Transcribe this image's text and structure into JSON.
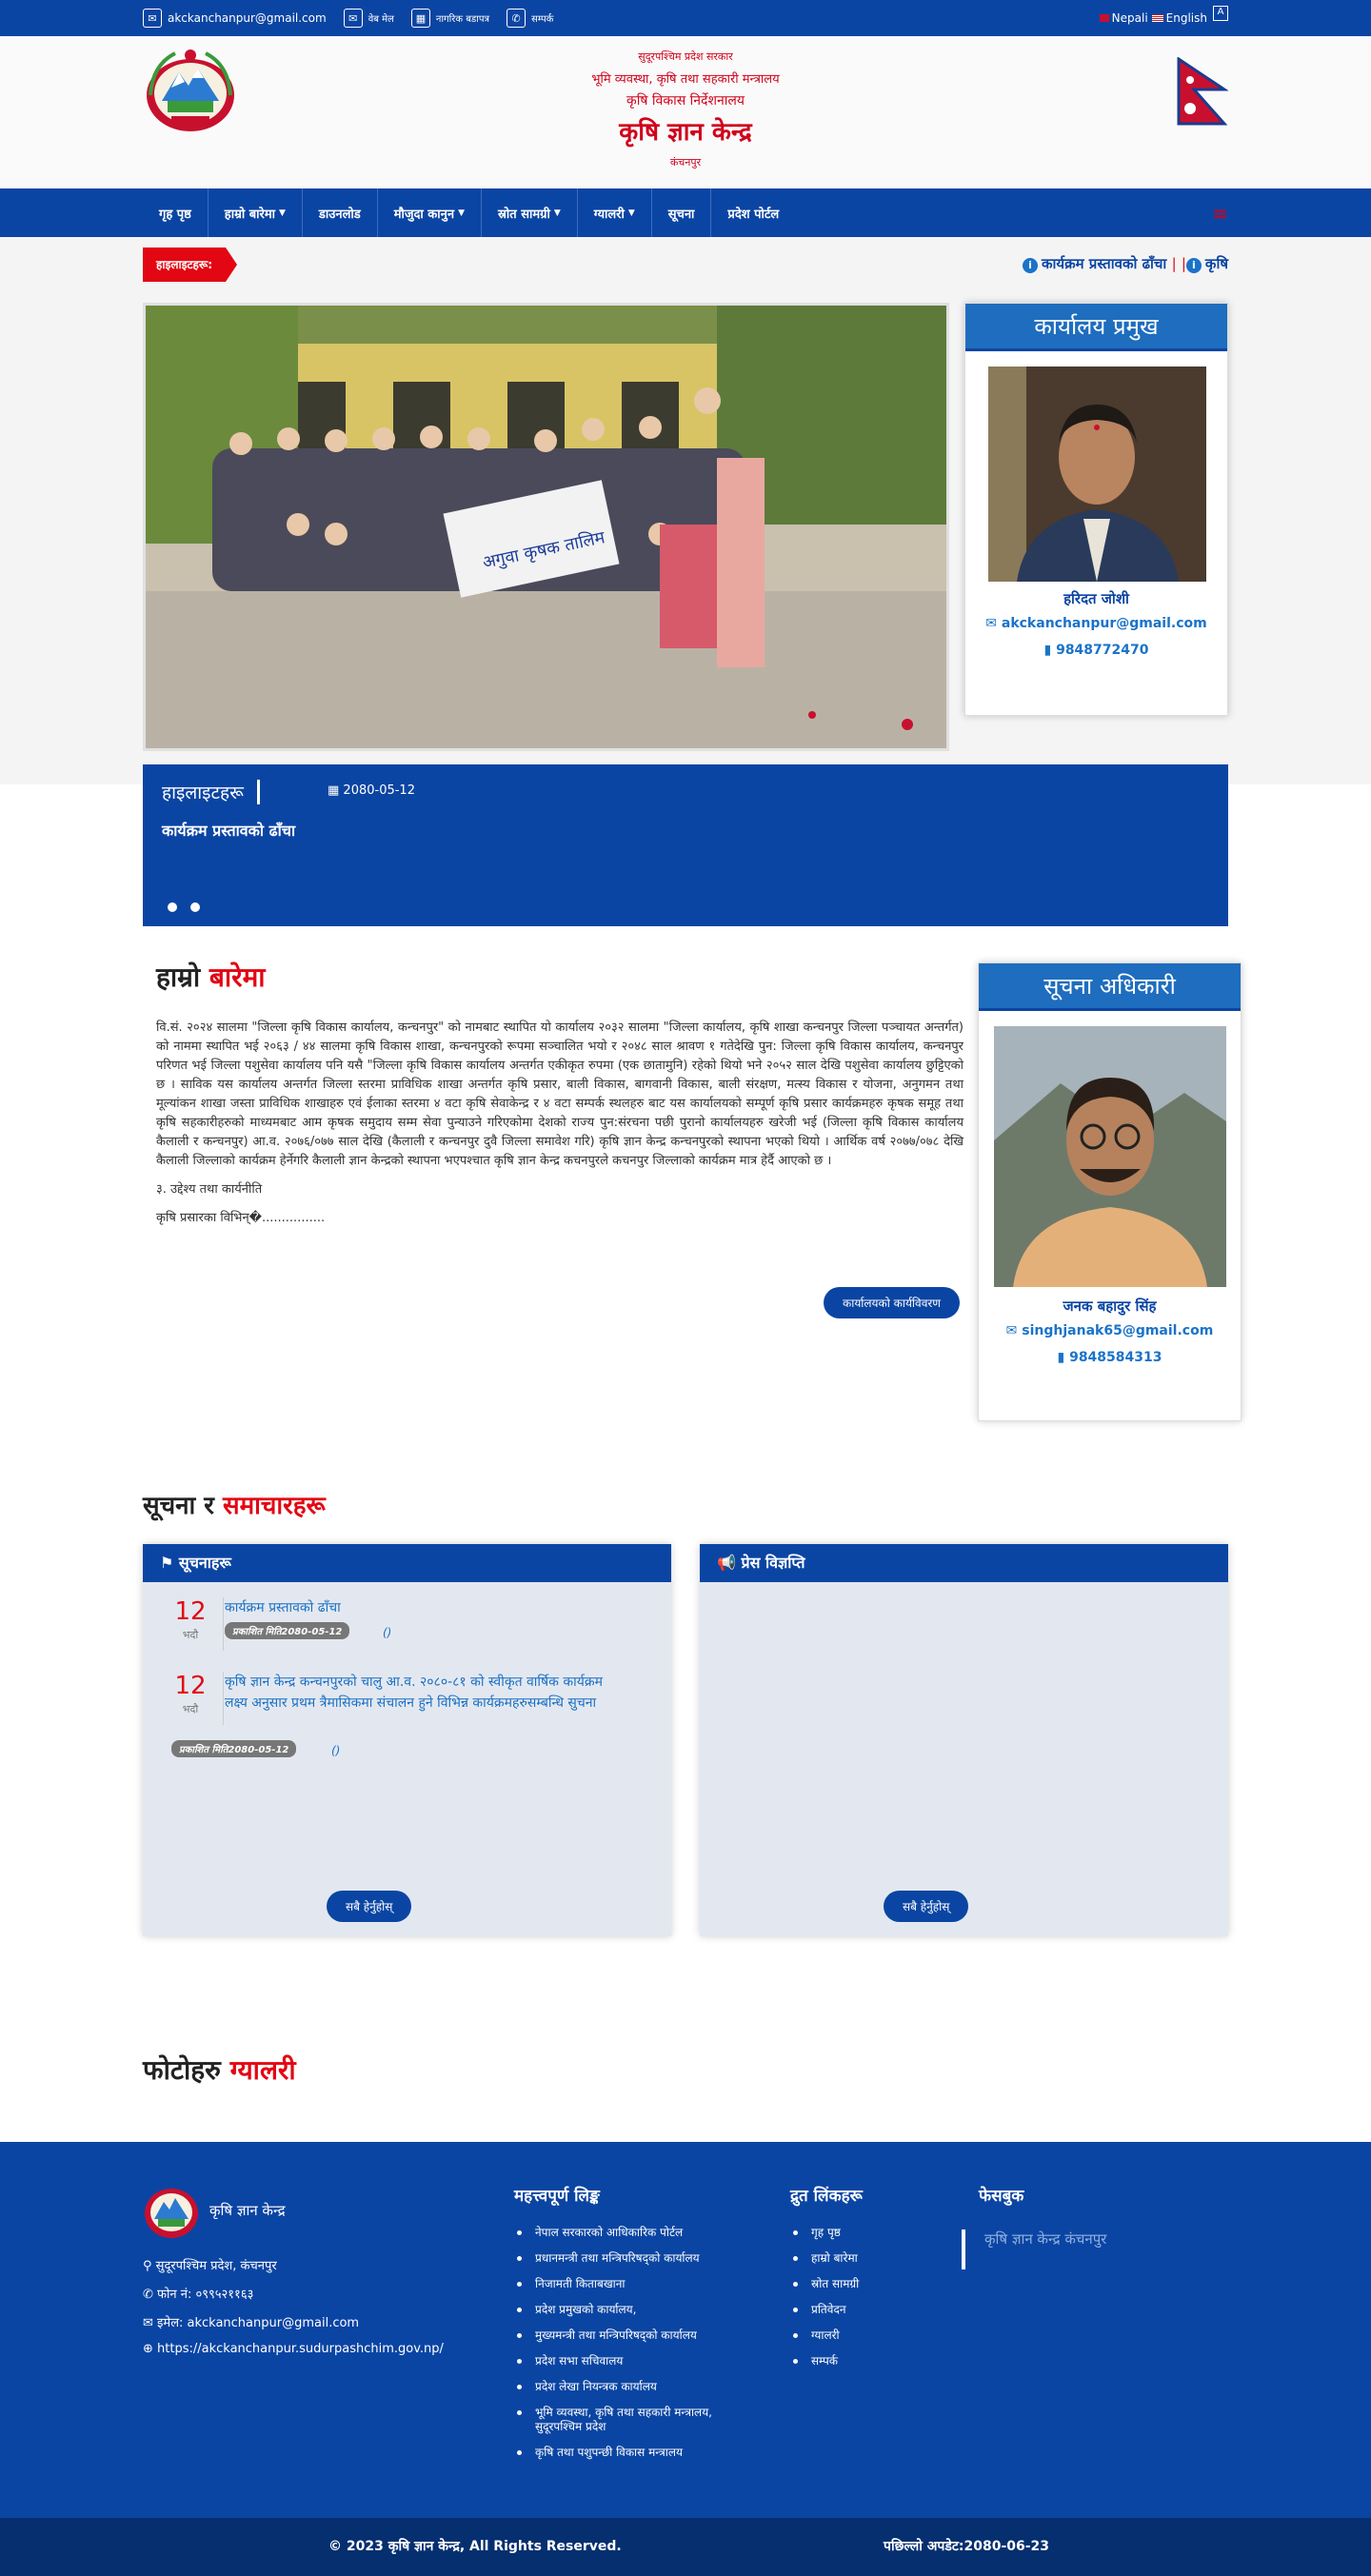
{
  "topbar": {
    "email": "akckanchanpur@gmail.com",
    "webmail": "वेब मेल",
    "charter": "नागरिक बडापत्र",
    "contact": "सम्पर्क",
    "lang_np": "Nepali",
    "lang_en": "English"
  },
  "header": {
    "line1": "सुदूरपश्चिम प्रदेश सरकार",
    "line2": "भूमि व्यवस्था, कृषि तथा सहकारी मन्त्रालय",
    "line3": "कृषि विकास निर्देशनालय",
    "title": "कृषि ज्ञान केन्द्र",
    "location": "कंचनपुर"
  },
  "nav": {
    "items": [
      {
        "label": "गृह पृष्ठ"
      },
      {
        "label": "हाम्रो बारेमा"
      },
      {
        "label": "डाउनलोड"
      },
      {
        "label": "मौजुदा कानुन"
      },
      {
        "label": "स्रोत सामग्री"
      },
      {
        "label": "ग्यालरी"
      },
      {
        "label": "सूचना"
      },
      {
        "label": "प्रदेश पोर्टल"
      }
    ]
  },
  "highlights": {
    "tag": "हाइलाइटहरू:",
    "ticker_1": "कार्यक्रम प्रस्तावको ढाँचा",
    "ticker_2": "कृषि"
  },
  "chief": {
    "title": "कार्यालय प्रमुख",
    "name": "हरिदत जोशी",
    "email": "akckanchanpur@gmail.com",
    "phone": "9848772470"
  },
  "slider": {
    "title": "हाइलाइटहरू",
    "date": "2080-05-12",
    "text": "कार्यक्रम प्रस्तावको ढाँचा",
    "banner_text": "अगुवा कृषक तालिम"
  },
  "about": {
    "title_a": "हाम्रो ",
    "title_b": "बारेमा",
    "para1": "वि.सं. २०२४ सालमा \"जिल्ला कृषि विकास कार्यालय, कन्चनपुर\" को नामबाट स्थापित यो कार्यालय २०३२ सालमा \"जिल्ला कार्यालय, कृषि शाखा कन्चनपुर जिल्ला पञ्चायत अन्तर्गत) को नाममा स्थापित भई २०६३ / ४४ सालमा कृषि विकास शाखा, कन्चनपुरको रूपमा सञ्चालित भयो र २०४८ साल श्रावण १ गतेदेखि पुन: जिल्ला कृषि विकास कार्यालय, कन्चनपुर परिणत भई जिल्ला पशुसेवा कार्यालय पनि यसै \"जिल्ला कृषि विकास कार्यालय अन्तर्गत एकीकृत रुपमा (एक छातामुनि) रहेको थियो भने २०५२ साल देखि पशुसेवा कार्यालय छुट्टिएको छ । साविक यस कार्यालय अन्तर्गत जिल्ला स्तरमा प्राविधिक शाखा अन्तर्गत कृषि प्रसार, बाली विकास, बागवानी विकास, बाली संरक्षण, मत्स्य विकास र योजना, अनुगमन तथा मूल्यांकन शाखा जस्ता प्राविधिक शाखाहरु एवं ईलाका स्तरमा ४ वटा कृषि सेवाकेन्द्र र ४ वटा सम्पर्क स्थलहरु बाट यस कार्यालयको सम्पूर्ण कृषि प्रसार कार्यक्रमहरु कृषक समूह तथा कृषि सहकारीहरुको माध्यमबाट आम कृषक समुदाय सम्म सेवा पुन्याउने गरिएकोमा देशको राज्य पुन:संरचना पछी पुरानो कार्यालयहरु खरेजी भई (जिल्ला कृषि विकास कार्यालय कैलाली र कन्चनपुर) आ.व. २०७६/०७७ साल देखि (कैलाली र कन्चनपुर दुवै जिल्ला समावेश गरि) कृषि ज्ञान केन्द्र कन्चनपुरको स्थापना भएको थियो । आर्थिक वर्ष २०७७/०७८ देखि कैलाली जिल्लाको कार्यक्रम हेर्नेगरि कैलाली ज्ञान केन्द्रको स्थापना भएपश्चात कृषि ज्ञान केन्द्र कचनपुरले कचनपुर जिल्लाको कार्यक्रम मात्र हेर्दै आएको छ ।",
    "para2": "३. उद्देश्य तथा कार्यनीति",
    "para3": "कृषि प्रसारका विभिन्�................",
    "button": "कार्यालयको कार्यविवरण"
  },
  "info_officer": {
    "title": "सूचना अधिकारी",
    "name": "जनक बहादुर सिंह",
    "email": "singhjanak65@gmail.com",
    "phone": "9848584313"
  },
  "news": {
    "title_a": "सूचना र ",
    "title_b": "समाचारहरू",
    "notices_head": "सूचनाहरू",
    "press_head": "प्रेस विज्ञप्ति",
    "items": [
      {
        "day": "12",
        "month": "भदौ",
        "text": "कार्यक्रम प्रस्तावको ढाँचा",
        "badge": "प्रकाशित मिति2080-05-12",
        "paren": "()"
      },
      {
        "day": "12",
        "month": "भदौ",
        "text": "कृषि ज्ञान केन्द्र कन्चनपुरको चालु आ.व. २०८०-८१ को स्वीकृत वार्षिक कार्यक्रम लक्ष्य अनुसार प्रथम त्रैमासिकमा संचालन हुने विभिन्न कार्यक्रमहरुसम्बन्धि सुचना",
        "badge": "प्रकाशित मिति2080-05-12",
        "paren": "()"
      }
    ],
    "see_all": "सबै हेर्नुहोस्"
  },
  "gallery": {
    "title_a": "फोटोहरु ",
    "title_b": "ग्यालरी"
  },
  "footer": {
    "org_name": "कृषि ज्ञान केन्द्र",
    "address": "सुदूरपश्चिम प्रदेश, कंचनपुर",
    "phone": "फोन नं: ०९९५२११६३",
    "email": "इमेल: akckanchanpur@gmail.com",
    "website": "https://akckanchanpur.sudurpashchim.gov.np/",
    "important_links_head": "महत्त्वपूर्ण लिङ्क",
    "important_links": [
      "नेपाल सरकारको आधिकारिक पोर्टल",
      "प्रधानमन्त्री तथा मन्त्रिपरिषद्को कार्यालय",
      "निजामती किताबखाना",
      "प्रदेश प्रमुखको कार्यालय,",
      "मुख्यमन्त्री तथा मन्त्रिपरिषद्को कार्यालय",
      "प्रदेश सभा सचिवालय",
      "प्रदेश लेखा नियन्त्रक कार्यालय",
      "भूमि व्यवस्था, कृषि तथा सहकारी मन्त्रालय, सुदूरपश्चिम प्रदेश",
      "कृषि तथा पशुपन्छी विकास मन्त्रालय"
    ],
    "quick_links_head": "द्रुत लिंकहरू",
    "quick_links": [
      "गृह पृष्ठ",
      "हाम्रो बारेमा",
      "स्रोत सामग्री",
      "प्रतिवेदन",
      "ग्यालरी",
      "सम्पर्क"
    ],
    "facebook_head": "फेसबुक",
    "facebook_link": "कृषि ज्ञान केन्द्र कंचनपुर",
    "copyright": "© 2023 कृषि ज्ञान केन्द्र, All Rights Reserved.",
    "last_updated": "पछिल्लो अपडेट:2080-06-23"
  },
  "colors": {
    "primary_blue": "#0b45a3",
    "accent_red": "#e30613",
    "link_blue": "#1a6fc4"
  }
}
